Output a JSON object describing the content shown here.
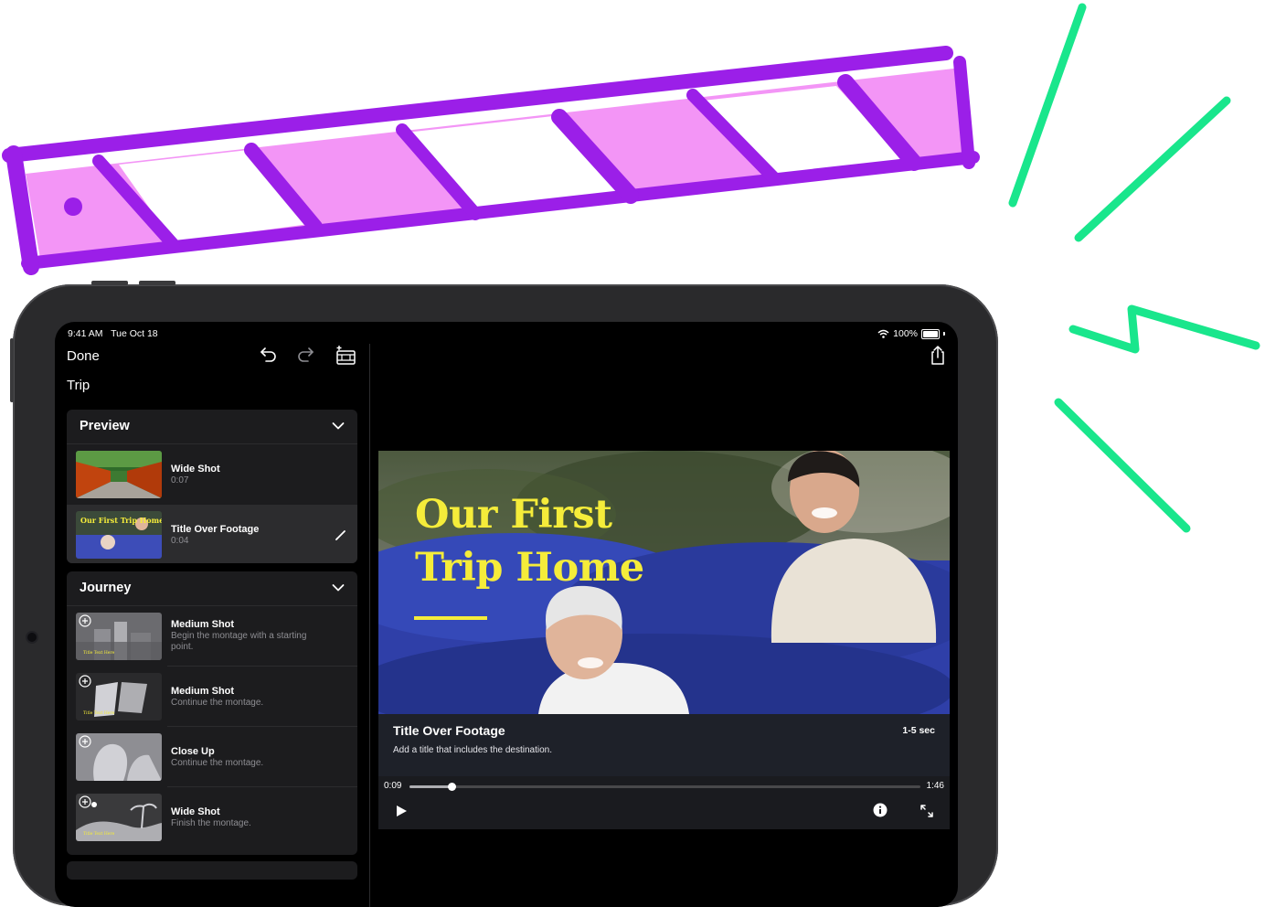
{
  "status_bar": {
    "time": "9:41 AM",
    "date": "Tue Oct 18",
    "battery": "100%"
  },
  "toolbar": {
    "done_label": "Done",
    "project_title": "Trip",
    "icons": [
      "undo-icon",
      "redo-icon",
      "add-clip-icon",
      "share-icon"
    ]
  },
  "sections": [
    {
      "title": "Preview",
      "rows": [
        {
          "title": "Wide Shot",
          "subtitle": "0:07",
          "selected": false
        },
        {
          "title": "Title Over Footage",
          "subtitle": "0:04",
          "selected": true,
          "thumb_text": "Our First Trip Home"
        }
      ]
    },
    {
      "title": "Journey",
      "rows": [
        {
          "title": "Medium Shot",
          "subtitle": "Begin the montage with a starting point.",
          "thumb_text": "Title Text Here"
        },
        {
          "title": "Medium Shot",
          "subtitle": "Continue the montage.",
          "thumb_text": "Title Text Here"
        },
        {
          "title": "Close Up",
          "subtitle": "Continue the montage."
        },
        {
          "title": "Wide Shot",
          "subtitle": "Finish the montage.",
          "thumb_text": "Title Text Here"
        }
      ]
    }
  ],
  "viewer": {
    "title_line1": "Our First",
    "title_line2": "Trip Home",
    "shot_title": "Title Over Footage",
    "shot_duration": "1-5 sec",
    "shot_description": "Add a title that includes the destination.",
    "current_time": "0:09",
    "total_time": "1:46",
    "progress": 0.083
  },
  "colors": {
    "title_yellow": "#f5ec3a",
    "clapper_purple": "#9b1fe8",
    "clapper_pink": "#f28cf5",
    "spark_green": "#19e68c"
  }
}
